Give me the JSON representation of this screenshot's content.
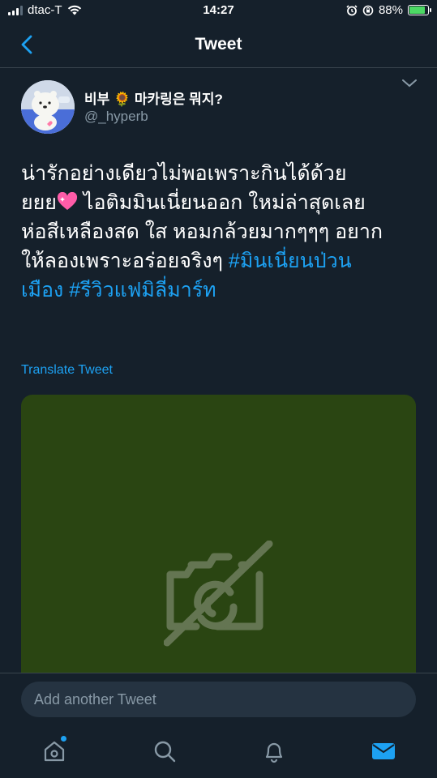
{
  "status_bar": {
    "carrier": "dtac-T",
    "time": "14:27",
    "battery_percent": "88%",
    "battery_level": 0.88
  },
  "navbar": {
    "title": "Tweet",
    "back_icon": "chevron-left-icon"
  },
  "tweet": {
    "author_name": "비부 🌻 마카링은 뭐지?",
    "author_handle": "@_hyperb",
    "text_line1": "น่ารักอย่างเดียวไม่พอเพราะกินได้ด้วย",
    "text_line2_a": "ยยย",
    "text_line2_b": " ไอติมมินเนี่ยนออก ใหม่ล่าสุดเลย",
    "text_line3": "ห่อสีเหลืองสด ใส หอมกล้วยมากๆๆๆ อยาก",
    "text_line4": "ให้ลองเพราะอร่อยจริงๆ ",
    "hashtag1_a": "#มินเนี่ยนป่วน",
    "hashtag1_b": "เมือง",
    "hashtag2": "#รีวิวแฟมิลี่มาร์ท",
    "translate_label": "Translate Tweet"
  },
  "reply": {
    "placeholder": "Add another Tweet"
  },
  "tabs": [
    {
      "name": "home",
      "icon": "home-icon",
      "has_notification": true
    },
    {
      "name": "search",
      "icon": "search-icon",
      "has_notification": false
    },
    {
      "name": "notifications",
      "icon": "bell-icon",
      "has_notification": false
    },
    {
      "name": "messages",
      "icon": "mail-icon",
      "active": true
    }
  ],
  "colors": {
    "background": "#15202b",
    "accent": "#1da1f2",
    "media_bg": "#2a4512",
    "heart": "#ff5ca8"
  }
}
